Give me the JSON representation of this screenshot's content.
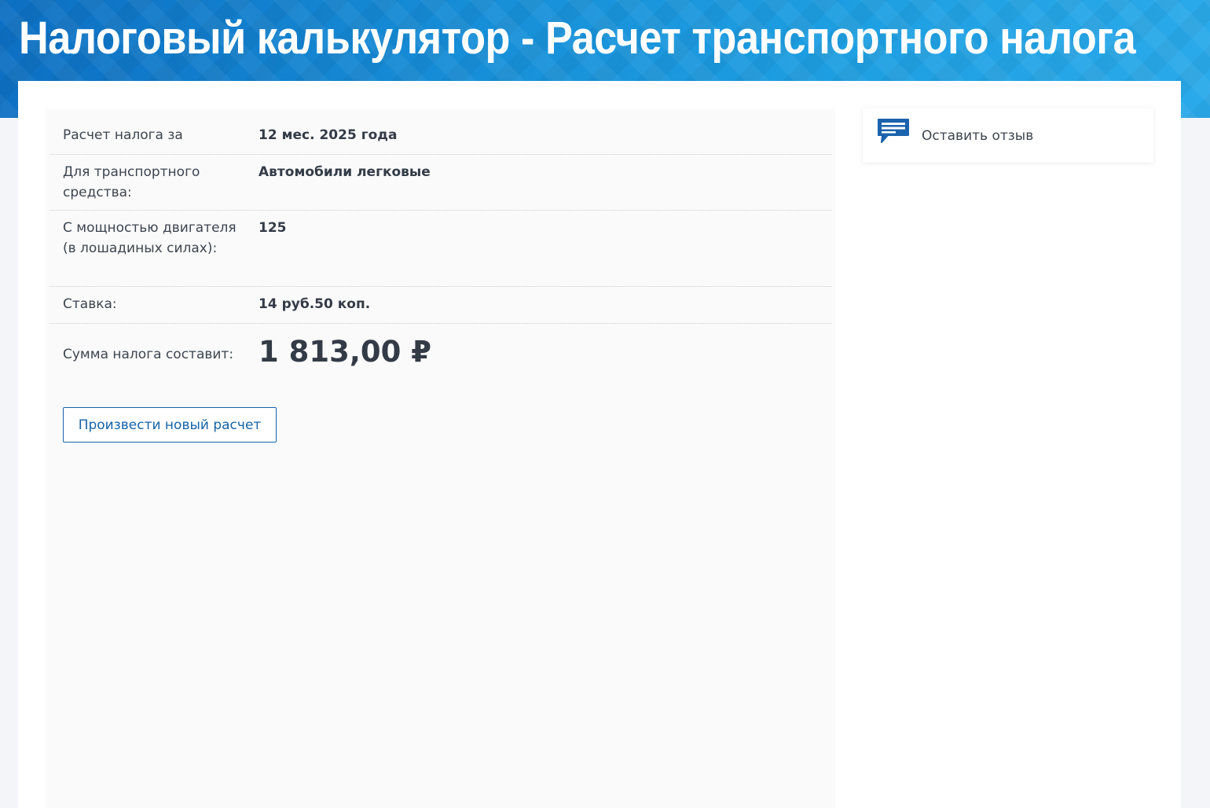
{
  "header": {
    "title": "Налоговый калькулятор - Расчет транспортного налога"
  },
  "result": {
    "rows": [
      {
        "label": "Расчет налога за",
        "value": "12 мес. 2025 года"
      },
      {
        "label": "Для транспортного средства:",
        "value": "Автомобили легковые"
      },
      {
        "label": "С мощностью двигателя (в лошадиных силах):",
        "value": "125"
      },
      {
        "label": "Ставка:",
        "value": "14 руб.50 коп."
      }
    ],
    "sum_label": "Сумма налога составит:",
    "sum_value": "1 813,00 ₽",
    "new_calc_label": "Произвести новый расчет"
  },
  "feedback": {
    "label": "Оставить отзыв",
    "icon": "feedback-speech-bubble-icon"
  },
  "colors": {
    "banner_start": "#0d6fc2",
    "banner_end": "#2aaaea",
    "accent": "#1663a8",
    "text": "#333b47"
  }
}
